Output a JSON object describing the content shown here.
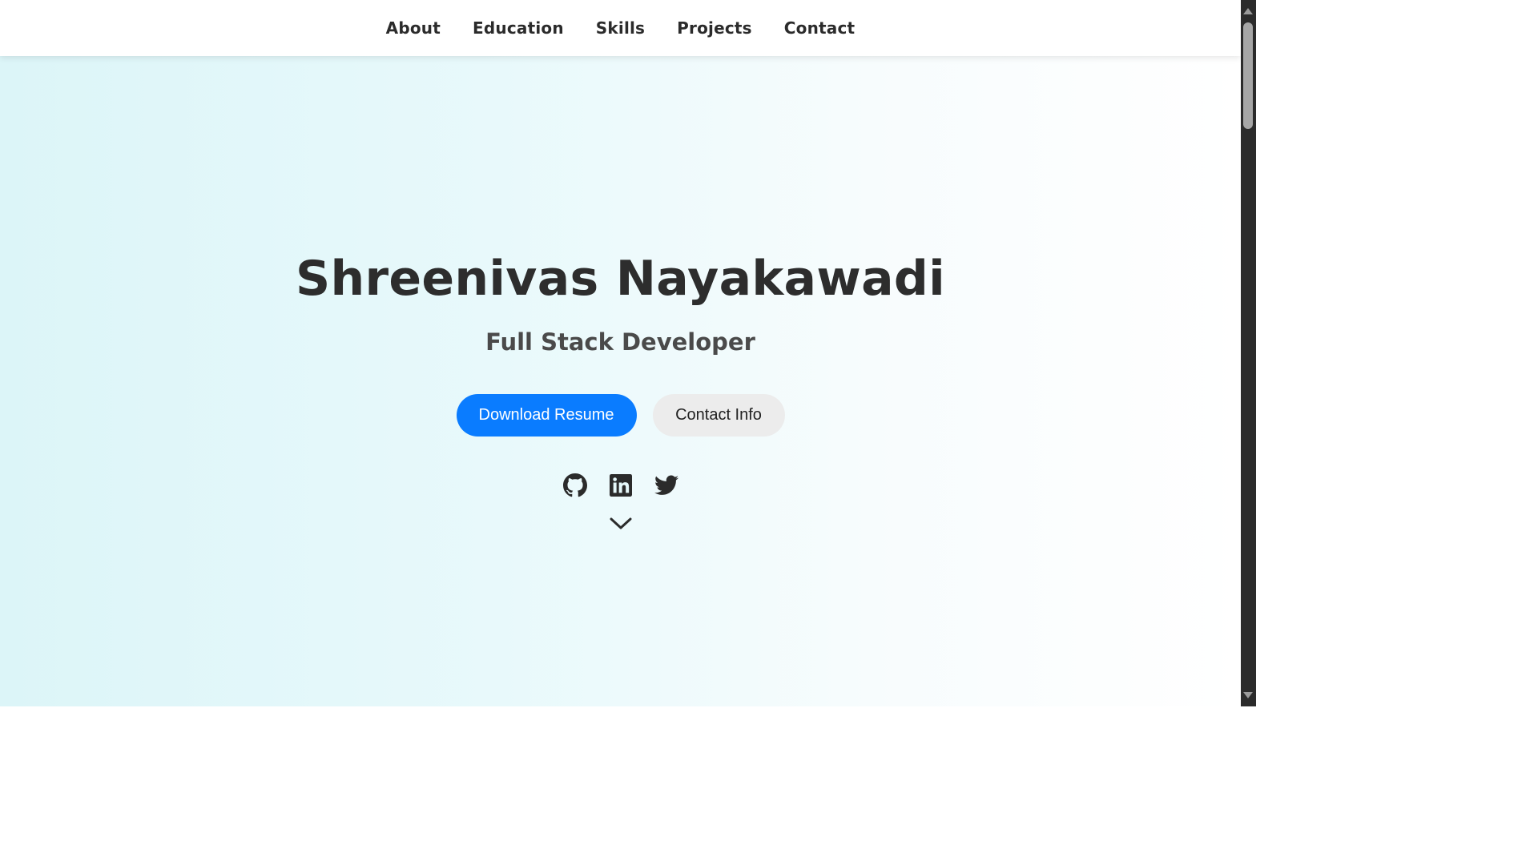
{
  "nav": {
    "items": [
      {
        "label": "About"
      },
      {
        "label": "Education"
      },
      {
        "label": "Skills"
      },
      {
        "label": "Projects"
      },
      {
        "label": "Contact"
      }
    ]
  },
  "hero": {
    "name": "Shreenivas Nayakawadi",
    "role": "Full Stack Developer",
    "primary_button": "Download Resume",
    "secondary_button": "Contact Info"
  },
  "social": {
    "icons": [
      "github-icon",
      "linkedin-icon",
      "twitter-icon"
    ]
  },
  "scroll_indicator": {
    "icon": "chevron-down-icon"
  },
  "colors": {
    "primary_button_bg": "#0a7cff",
    "secondary_button_bg": "#ececec",
    "text_dark": "#2d2d2d",
    "gradient_start": "#dcf5f8",
    "gradient_end": "#ffffff"
  }
}
